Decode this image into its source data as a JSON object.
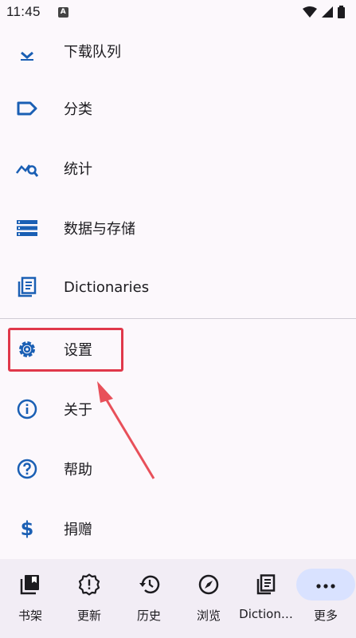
{
  "status_bar": {
    "time": "11:45",
    "notification": "A"
  },
  "menu": {
    "items": [
      {
        "label": "下载队列",
        "icon": "download-icon"
      },
      {
        "label": "分类",
        "icon": "label-icon"
      },
      {
        "label": "统计",
        "icon": "statistics-icon"
      },
      {
        "label": "数据与存储",
        "icon": "storage-icon"
      },
      {
        "label": "Dictionaries",
        "icon": "dictionaries-icon"
      },
      {
        "label": "设置",
        "icon": "gear-icon"
      },
      {
        "label": "关于",
        "icon": "info-icon"
      },
      {
        "label": "帮助",
        "icon": "help-icon"
      },
      {
        "label": "捐赠",
        "icon": "dollar-icon"
      }
    ]
  },
  "bottom_nav": {
    "items": [
      {
        "label": "书架",
        "icon": "library-icon"
      },
      {
        "label": "更新",
        "icon": "updates-icon"
      },
      {
        "label": "历史",
        "icon": "history-icon"
      },
      {
        "label": "浏览",
        "icon": "compass-icon"
      },
      {
        "label": "Diction…",
        "icon": "dictionaries-icon"
      },
      {
        "label": "更多",
        "icon": "more-icon",
        "active": true
      }
    ]
  },
  "colors": {
    "accent": "#1a5fb4",
    "highlight": "#e0384a",
    "active_pill": "#d9e2ff"
  }
}
